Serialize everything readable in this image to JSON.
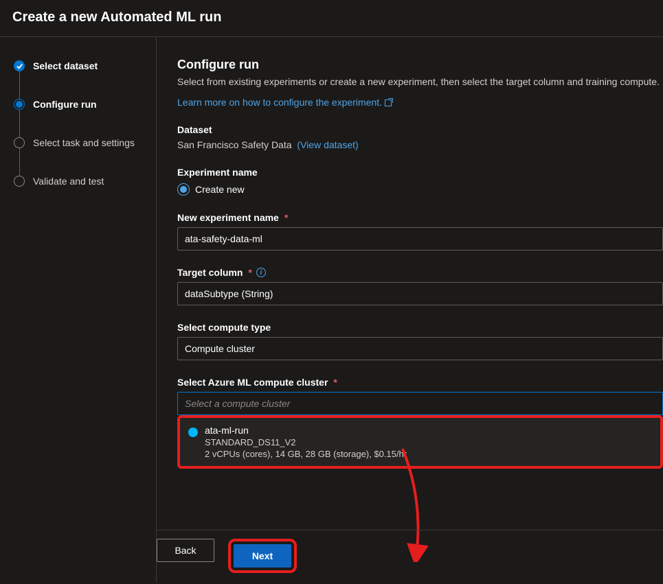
{
  "header": {
    "title": "Create a new Automated ML run"
  },
  "sidebar": {
    "steps": [
      {
        "label": "Select dataset"
      },
      {
        "label": "Configure run"
      },
      {
        "label": "Select task and settings"
      },
      {
        "label": "Validate and test"
      }
    ]
  },
  "main": {
    "title": "Configure run",
    "subtitle": "Select from existing experiments or create a new experiment, then select the target column and training compute.",
    "learn_more": "Learn more on how to configure the experiment.",
    "dataset_label": "Dataset",
    "dataset_value": "San Francisco Safety Data",
    "view_dataset": "(View dataset)",
    "experiment_label": "Experiment name",
    "radio_create_new": "Create new",
    "new_experiment_label": "New experiment name",
    "new_experiment_value": "ata-safety-data-ml",
    "target_column_label": "Target column",
    "target_column_value": "dataSubtype (String)",
    "compute_type_label": "Select compute type",
    "compute_type_value": "Compute cluster",
    "cluster_label": "Select Azure ML compute cluster",
    "cluster_placeholder": "Select a compute cluster",
    "cluster_option": {
      "name": "ata-ml-run",
      "sku": "STANDARD_DS11_V2",
      "specs": "2 vCPUs (cores), 14 GB, 28 GB (storage), $0.15/hr"
    }
  },
  "footer": {
    "back": "Back",
    "next": "Next"
  }
}
